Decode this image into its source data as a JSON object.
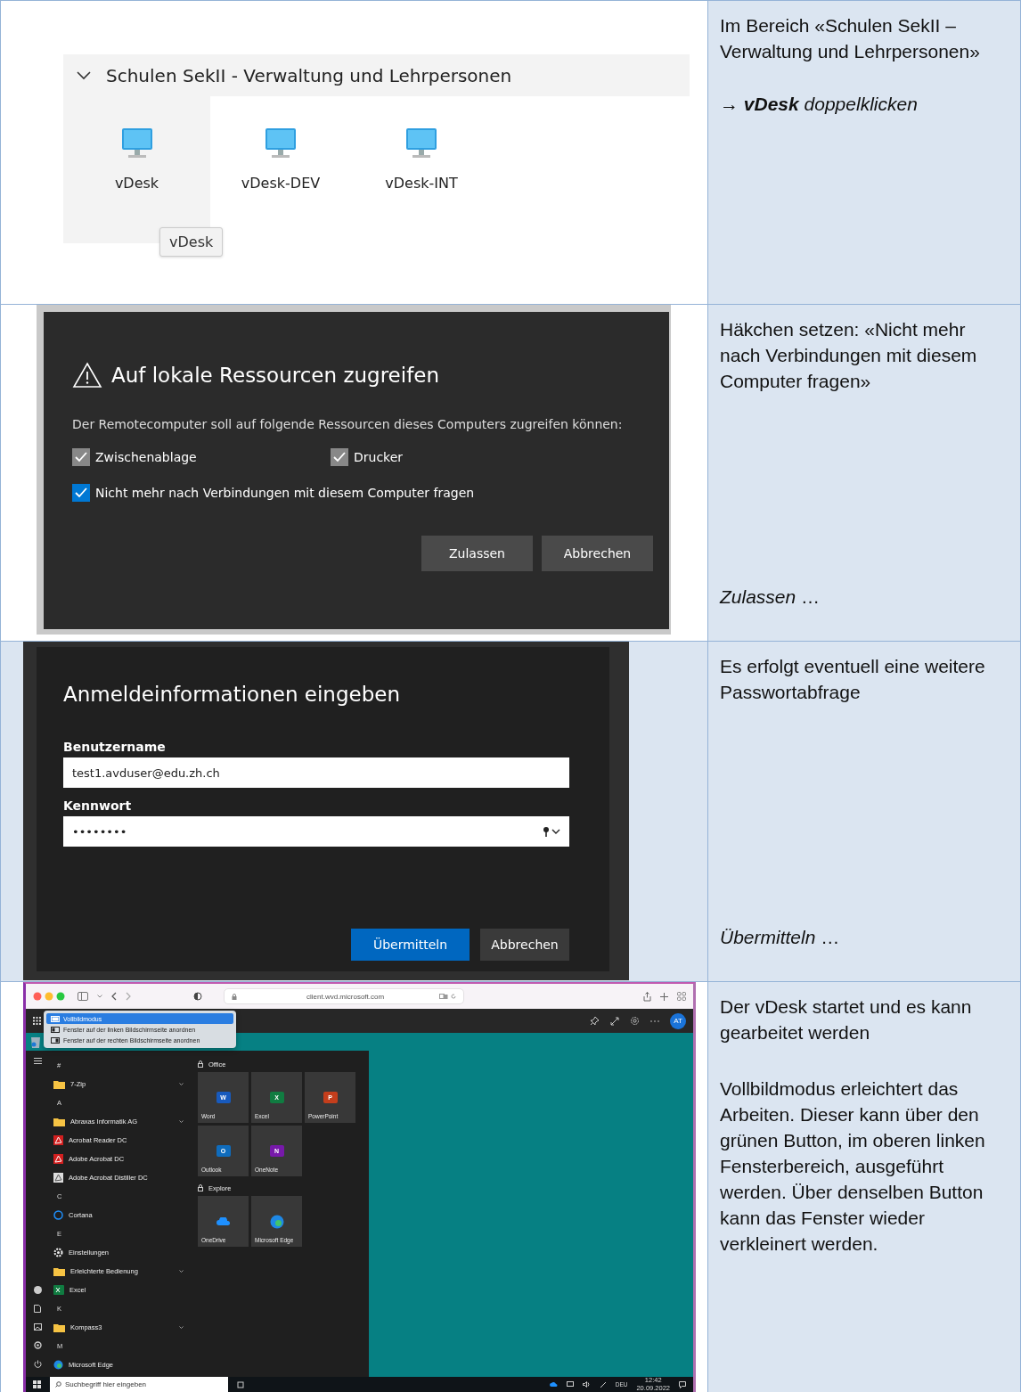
{
  "rows": [
    {
      "kind": "explorer",
      "screenshot": {
        "group": {
          "title": "Schulen SekII - Verwaltung und Lehrpersonen",
          "expanded": true
        },
        "items": [
          {
            "label": "vDesk",
            "selected": true
          },
          {
            "label": "vDesk-DEV",
            "selected": false
          },
          {
            "label": "vDesk-INT",
            "selected": false
          }
        ],
        "tooltip": "vDesk"
      },
      "notes": [
        {
          "kind": "text",
          "text": "Im Bereich «Schulen SekII – Verwaltung und Lehrpersonen»"
        },
        {
          "kind": "instruction",
          "text": "→ **vDesk** doppelklicken"
        }
      ]
    },
    {
      "kind": "permission",
      "screenshot": {
        "title": "Auf lokale Ressourcen zugreifen",
        "description": "Der Remotecomputer soll auf folgende Ressourcen dieses Computers zugreifen können:",
        "options": [
          {
            "label": "Zwischenablage",
            "checked": true,
            "disabled": true
          },
          {
            "label": "Drucker",
            "checked": true,
            "disabled": true
          },
          {
            "label": "Nicht mehr nach Verbindungen mit diesem Computer fragen",
            "checked": true,
            "disabled": false
          }
        ],
        "buttons": [
          {
            "label": "Zulassen",
            "primary": false
          },
          {
            "label": "Abbrechen",
            "primary": false
          }
        ]
      },
      "notes": [
        {
          "kind": "text",
          "text": "Häkchen setzen: «Nicht mehr nach Verbindungen mit diesem Computer fragen»"
        },
        {
          "kind": "action",
          "text": "*Zulassen* …"
        }
      ]
    },
    {
      "kind": "login",
      "screenshot": {
        "title": "Anmeldeinformationen eingeben",
        "fields": [
          {
            "kind": "text",
            "label": "Benutzername",
            "value": "test1.avduser@edu.zh.ch"
          },
          {
            "kind": "password",
            "label": "Kennwort",
            "value": "••••••••"
          }
        ],
        "buttons": [
          {
            "label": "Übermitteln",
            "primary": true
          },
          {
            "label": "Abbrechen",
            "primary": false
          }
        ]
      },
      "notes": [
        {
          "kind": "text",
          "text": "Es erfolgt eventuell eine weitere Passwortabfrage"
        },
        {
          "kind": "action",
          "text": "*Übermitteln* …"
        }
      ]
    },
    {
      "kind": "desktop",
      "screenshot": {
        "address": "client.wvd.microsoft.com",
        "menu": [
          {
            "label": "Vollbildmodus",
            "selected": true
          },
          {
            "label": "Fenster auf der linken Bildschirmseite anordnen",
            "selected": false
          },
          {
            "label": "Fenster auf der rechten Bildschirmseite anordnen",
            "selected": false
          }
        ],
        "avatar": "AT",
        "apps": [
          {
            "kind": "letter",
            "label": "#"
          },
          {
            "kind": "folder",
            "label": "7-Zip"
          },
          {
            "kind": "letter",
            "label": "A"
          },
          {
            "kind": "folder",
            "label": "Abraxas Informatik AG"
          },
          {
            "kind": "pdf",
            "label": "Acrobat Reader DC"
          },
          {
            "kind": "pdf",
            "label": "Adobe Acrobat DC"
          },
          {
            "kind": "distiller",
            "label": "Adobe Acrobat Distiller DC"
          },
          {
            "kind": "letter",
            "label": "C"
          },
          {
            "kind": "cortana",
            "label": "Cortana"
          },
          {
            "kind": "letter",
            "label": "E"
          },
          {
            "kind": "settings",
            "label": "Einstellungen"
          },
          {
            "kind": "folder",
            "label": "Erleichterte Bedienung"
          },
          {
            "kind": "excel",
            "label": "Excel"
          },
          {
            "kind": "letter",
            "label": "K"
          },
          {
            "kind": "folder",
            "label": "Kompass3"
          },
          {
            "kind": "letter",
            "label": "M"
          },
          {
            "kind": "edge",
            "label": "Microsoft Edge"
          }
        ],
        "tile_groups": [
          {
            "title": "Office",
            "tiles": [
              {
                "kind": "word",
                "glyph": "W",
                "label": "Word"
              },
              {
                "kind": "excel",
                "glyph": "X",
                "label": "Excel"
              },
              {
                "kind": "powerpoint",
                "glyph": "P",
                "label": "PowerPoint"
              },
              {
                "kind": "outlook",
                "glyph": "O",
                "label": "Outlook"
              },
              {
                "kind": "onenote",
                "glyph": "N",
                "label": "OneNote"
              }
            ]
          },
          {
            "title": "Explore",
            "tiles": [
              {
                "kind": "onedrive",
                "label": "OneDrive"
              },
              {
                "kind": "edge",
                "label": "Microsoft Edge"
              }
            ]
          }
        ],
        "taskbar": {
          "placeholder": "Suchbegriff hier eingeben",
          "language": "DEU",
          "time": "12:42",
          "date": "20.09.2022"
        }
      },
      "notes": [
        {
          "kind": "text",
          "text": "Der vDesk startet und es kann gearbeitet werden"
        },
        {
          "kind": "text",
          "text": "Vollbildmodus erleichtert das Arbeiten. Dieser kann über den grünen Button, im oberen linken Fensterbereich, ausgeführt werden. Über denselben Button kann das Fenster wieder verkleinert werden."
        }
      ]
    }
  ]
}
